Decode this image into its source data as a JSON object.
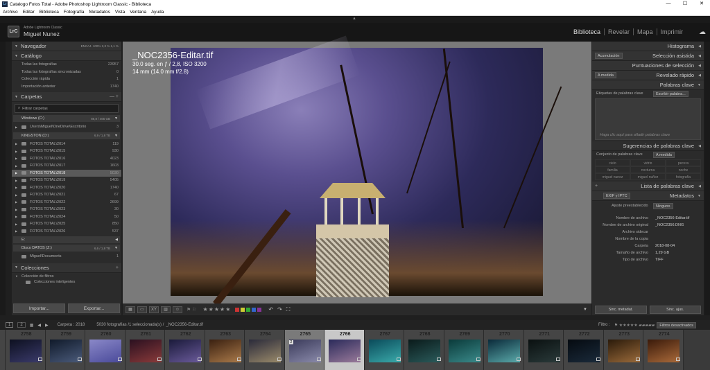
{
  "titlebar": {
    "title": "Catalogo Fotos Total - Adobe Photoshop Lightroom Classic - Biblioteca",
    "icon": "lr-icon"
  },
  "menu": [
    "Archivo",
    "Editar",
    "Biblioteca",
    "Fotografía",
    "Metadatos",
    "Vista",
    "Ventana",
    "Ayuda"
  ],
  "identity": {
    "brand": "Adobe Lightroom Classic",
    "user": "Miguel Nunez",
    "logo": "LrC"
  },
  "modules": [
    "Biblioteca",
    "Revelar",
    "Mapa",
    "Imprimir"
  ],
  "navigator": {
    "label": "Navegador",
    "zoom": [
      "ENCAJ.",
      "100%",
      "3,3 %",
      "1,1 %"
    ]
  },
  "catalog": {
    "label": "Catálogo",
    "items": [
      {
        "label": "Todas las fotografías",
        "count": "23957"
      },
      {
        "label": "Todas las fotografías sincronizadas",
        "count": "0"
      },
      {
        "label": "Colección rápida",
        "count": "1"
      },
      {
        "label": "Importación anterior",
        "count": "1740"
      }
    ]
  },
  "folders": {
    "label": "Carpetas",
    "filter": "Filtrar carpetas",
    "vol1": {
      "name": "Windows (C:)",
      "cap": "86,8 / 465 GB"
    },
    "vol1_items": [
      {
        "label": "Users\\Miguel\\OneDrive\\Escritorio",
        "count": "3"
      }
    ],
    "vol2": {
      "name": "KINGSTON (D:)",
      "cap": "6,9 / 1,8 TB"
    },
    "vol2_items": [
      {
        "label": "FOTOS TOTAL\\2014",
        "count": "119"
      },
      {
        "label": "FOTOS TOTAL\\2015",
        "count": "930"
      },
      {
        "label": "FOTOS TOTAL\\2016",
        "count": "4023"
      },
      {
        "label": "FOTOS TOTAL\\2017",
        "count": "1603"
      },
      {
        "label": "FOTOS TOTAL\\2018",
        "count": "5030"
      },
      {
        "label": "FOTOS TOTAL\\2019",
        "count": "5405"
      },
      {
        "label": "FOTOS TOTAL\\2020",
        "count": "1740"
      },
      {
        "label": "FOTOS TOTAL\\2021",
        "count": "67"
      },
      {
        "label": "FOTOS TOTAL\\2022",
        "count": "2699"
      },
      {
        "label": "FOTOS TOTAL\\2023",
        "count": "30"
      },
      {
        "label": "FOTOS TOTAL\\2024",
        "count": "50"
      },
      {
        "label": "FOTOS TOTAL\\2025",
        "count": "850"
      },
      {
        "label": "FOTOS TOTAL\\2026",
        "count": "537"
      }
    ],
    "vol3": {
      "name": "E:"
    },
    "vol4": {
      "name": "Disco DATOS (Z:)",
      "cap": "6,6 / 1,8 TB"
    },
    "vol4_items": [
      {
        "label": "Miguel\\Documents",
        "count": "1"
      }
    ]
  },
  "collections": {
    "label": "Colecciones",
    "items": [
      "Colección de filtros",
      "Colecciones inteligentes"
    ]
  },
  "buttons": {
    "import": "Importar...",
    "export": "Exportar..."
  },
  "photo": {
    "filename": "_NOC2356-Editar.tif",
    "exposure": "30.0 seg. en ƒ / 2,8, ISO 3200",
    "lens": "14 mm (14.0 mm f/2.8)"
  },
  "right": {
    "histogram": "Histograma",
    "quick_collection": "Selección asistida",
    "quick_collection_label": "Acumulación",
    "ratings": "Puntuaciones de selección",
    "quick_develop": "Revelado rápido",
    "quick_develop_mode": "A medida",
    "keywording": "Palabras clave",
    "kw_tags_label": "Etiquetas de palabras clave",
    "kw_tags_mode": "Escribir palabra...",
    "kw_hint": "Haga clic aquí para añadir palabras clave",
    "kw_suggest": "Sugerencias de palabras clave",
    "kw_set": "Conjunto de palabras clave",
    "kw_set_mode": "A medida",
    "kw_grid": [
      "cielo",
      "vidrio",
      "pecera",
      "familia",
      "nocturna",
      "noche",
      "miguel nunez",
      "miguel nuñez",
      "fotografía"
    ],
    "kw_list": "Lista de palabras clave",
    "metadata": "Metadatos",
    "meta_mode": "EXIF y IPTC",
    "preset_label": "Ajuste preestablecido",
    "preset_value": "Ninguno",
    "fields": [
      {
        "k": "Nombre de archivo",
        "v": "_NOC2356-Editar.tif"
      },
      {
        "k": "Nombre de archivo original",
        "v": "_NOC2356.DNG"
      },
      {
        "k": "Archivo sidecar",
        "v": ""
      },
      {
        "k": "Nombre de la copia",
        "v": ""
      },
      {
        "k": "Carpeta",
        "v": "2018-08-04"
      },
      {
        "k": "Tamaño de archivo",
        "v": "1,29 GB"
      },
      {
        "k": "Tipo de archivo",
        "v": "TIFF"
      }
    ],
    "sync_meta": "Sinc. metadat.",
    "sync": "Sinc. ajus."
  },
  "filmheader": {
    "pages": [
      "1",
      "2"
    ],
    "folder": "Carpeta : 2018",
    "status": "5030 fotografías /1 seleccionada(s) /",
    "file": "_NOC2356-Editar.tif",
    "filter_label": "Filtro :",
    "filter_value": "Filtros desactivados"
  },
  "filmstrip": {
    "numbers": [
      "2758",
      "2759",
      "2760",
      "2761",
      "2762",
      "2763",
      "2764",
      "2765",
      "2766",
      "2767",
      "2768",
      "2769",
      "2770",
      "2771",
      "2772",
      "2773",
      "2774"
    ],
    "selected": "2766",
    "hint_badge": "2"
  },
  "colors": {
    "panel": "#2b2b2b",
    "accent_selected": "#5a5a5a",
    "photo_sky": "#5a4f8f"
  }
}
